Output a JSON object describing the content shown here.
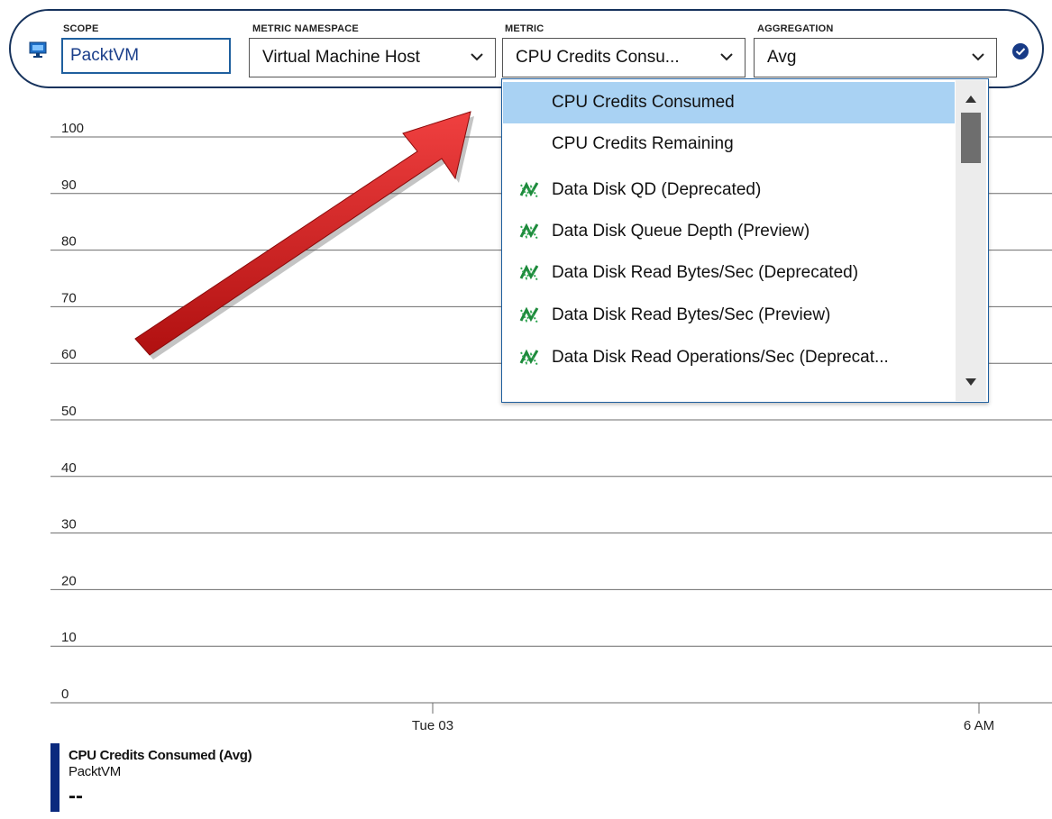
{
  "toolbar": {
    "scope_label": "SCOPE",
    "scope_value": "PacktVM",
    "namespace_label": "METRIC NAMESPACE",
    "namespace_value": "Virtual Machine Host",
    "metric_label": "METRIC",
    "metric_value": "CPU Credits Consu...",
    "aggregation_label": "AGGREGATION",
    "aggregation_value": "Avg"
  },
  "metric_dropdown": {
    "items": [
      {
        "label": "CPU Credits Consumed",
        "icon": "none",
        "selected": true
      },
      {
        "label": "CPU Credits Remaining",
        "icon": "none",
        "selected": false
      },
      {
        "label": "Data Disk QD (Deprecated)",
        "icon": "metric-icon",
        "selected": false
      },
      {
        "label": "Data Disk Queue Depth (Preview)",
        "icon": "metric-icon",
        "selected": false
      },
      {
        "label": "Data Disk Read Bytes/Sec (Deprecated)",
        "icon": "metric-icon",
        "selected": false
      },
      {
        "label": "Data Disk Read Bytes/Sec (Preview)",
        "icon": "metric-icon",
        "selected": false
      },
      {
        "label": "Data Disk Read Operations/Sec (Deprecat...",
        "icon": "metric-icon",
        "selected": false
      }
    ]
  },
  "chart_data": {
    "type": "line",
    "y_ticks": [
      "100",
      "90",
      "80",
      "70",
      "60",
      "50",
      "40",
      "30",
      "20",
      "10",
      "0"
    ],
    "x_ticks": [
      "Tue 03",
      "6 AM"
    ],
    "ylim": [
      0,
      100
    ],
    "series": [
      {
        "name": "CPU Credits Consumed (Avg)",
        "values": []
      }
    ]
  },
  "legend": {
    "title": "CPU Credits Consumed (Avg)",
    "subtitle": "PacktVM",
    "value": "--"
  },
  "colors": {
    "toolbar_border": "#16325c",
    "selected_item": "#a9d2f3",
    "legend_series": "#0b2a7e",
    "metric_icon": "#1e8a3c",
    "arrow": "#d42020"
  }
}
